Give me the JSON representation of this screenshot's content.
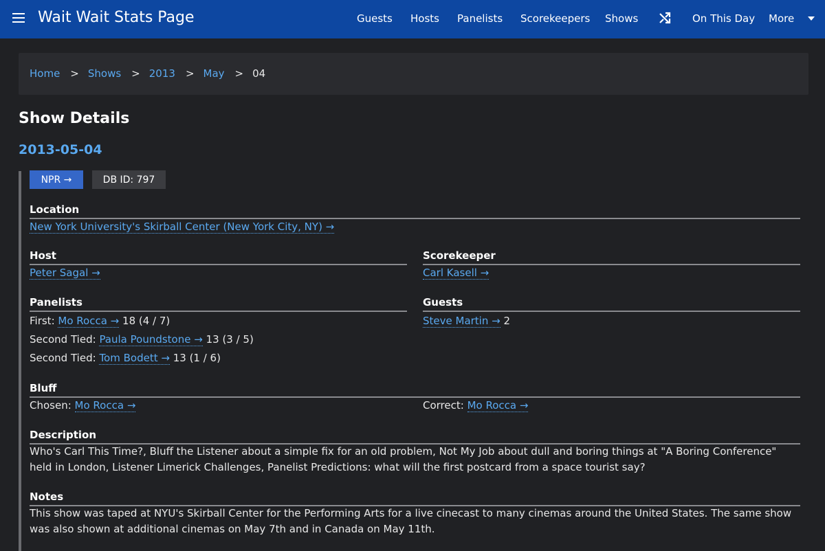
{
  "header": {
    "brand": "Wait Wait Stats Page",
    "nav": {
      "guests": "Guests",
      "hosts": "Hosts",
      "panelists": "Panelists",
      "scorekeepers": "Scorekeepers",
      "shows": "Shows",
      "on_this_day": "On This Day",
      "more": "More"
    },
    "icons": [
      "hamburger-menu-icon",
      "shuffle-icon",
      "caret-down-icon"
    ]
  },
  "breadcrumb": {
    "home": "Home",
    "shows": "Shows",
    "year": "2013",
    "month": "May",
    "day": "04",
    "separator": ">"
  },
  "page": {
    "title": "Show Details",
    "show_date": "2013-05-04",
    "npr_button": "NPR →",
    "db_id": "DB ID: 797"
  },
  "location": {
    "heading": "Location",
    "value": "New York University's Skirball Center (New York City, NY) →"
  },
  "host": {
    "heading": "Host",
    "name": "Peter Sagal →"
  },
  "scorekeeper": {
    "heading": "Scorekeeper",
    "name": "Carl Kasell →"
  },
  "panelists": {
    "heading": "Panelists",
    "rows": [
      {
        "rank": "First:",
        "name": "Mo Rocca →",
        "score": "18 (4 / 7)"
      },
      {
        "rank": "Second Tied:",
        "name": "Paula Poundstone →",
        "score": "13 (3 / 5)"
      },
      {
        "rank": "Second Tied:",
        "name": "Tom Bodett →",
        "score": "13 (1 / 6)"
      }
    ]
  },
  "guests": {
    "heading": "Guests",
    "rows": [
      {
        "name": "Steve Martin →",
        "score": "2"
      }
    ]
  },
  "bluff": {
    "heading": "Bluff",
    "chosen_label": "Chosen:",
    "chosen_name": "Mo Rocca →",
    "correct_label": "Correct:",
    "correct_name": "Mo Rocca →"
  },
  "description": {
    "heading": "Description",
    "text": "Who's Carl This Time?, Bluff the Listener about a simple fix for an old problem, Not My Job about dull and boring things at \"A Boring Conference\" held in London, Listener Limerick Challenges, Panelist Predictions: what will the first postcard from a space tourist say?"
  },
  "notes": {
    "heading": "Notes",
    "text": "This show was taped at NYU's Skirball Center for the Performing Arts for a live cinecast to many cinemas around the United States. The same show was also shown at additional cinemas on May 7th and in Canada on May 11th."
  },
  "colors": {
    "header_bg": "#0d47a1",
    "page_bg": "#202124",
    "link": "#5aa9f0",
    "npr_button": "#3567c8"
  }
}
